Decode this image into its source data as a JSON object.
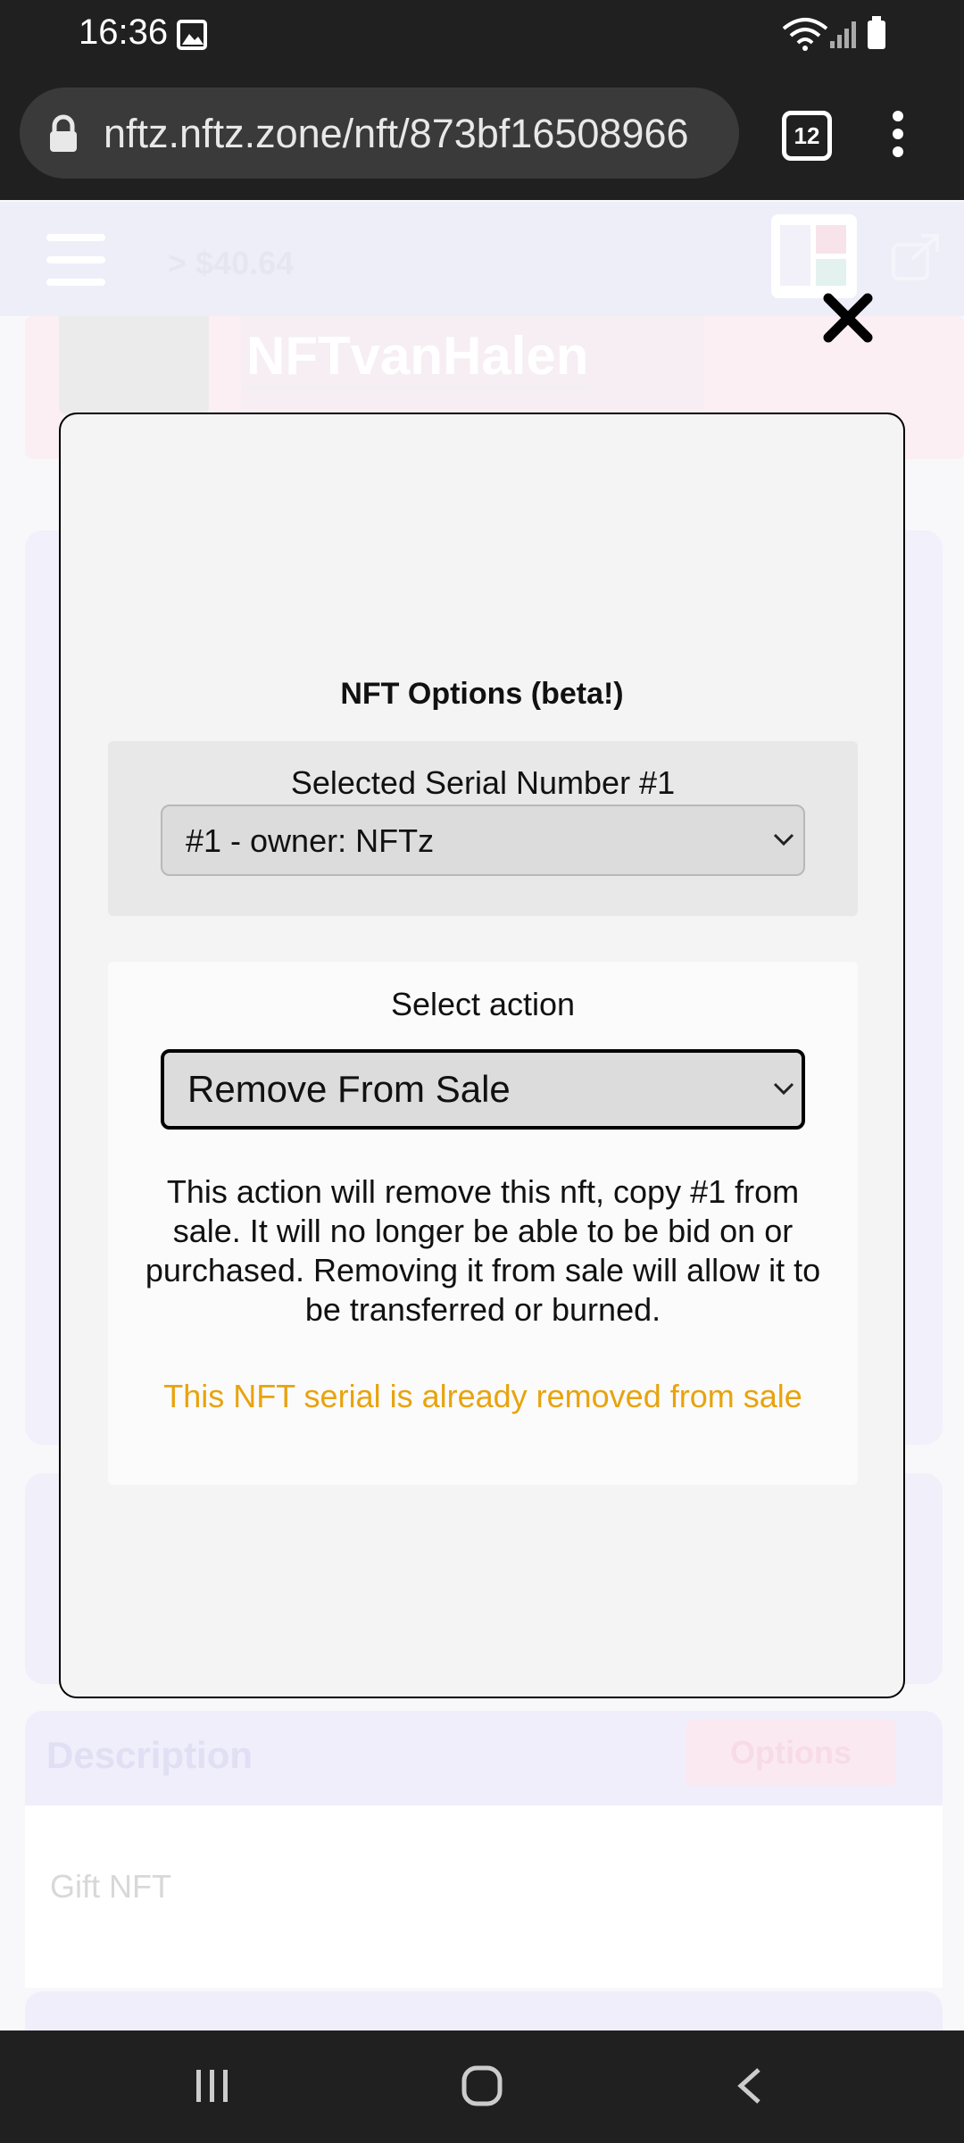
{
  "status_bar": {
    "time": "16:36"
  },
  "browser": {
    "url": "nftz.nftz.zone/nft/873bf16508966",
    "tab_count": "12"
  },
  "background_page": {
    "balance": "> $40.64",
    "profile_name": "NFTvanHalen",
    "description_title": "Description",
    "options_button": "Options",
    "description_text": "Gift NFT"
  },
  "modal": {
    "title": "NFT Options (beta!)",
    "serial_label": "Selected Serial Number #1",
    "serial_selected": "#1 - owner: NFTz",
    "action_label": "Select action",
    "action_selected": "Remove From Sale",
    "action_description": "This action will remove this nft, copy #1 from sale. It will no longer be able to be bid on or purchased. Removing it from sale will allow it to be transferred or burned.",
    "warning": "This NFT serial is already removed from sale"
  },
  "colors": {
    "warning": "#e8a30d",
    "system_bar": "#202020"
  }
}
